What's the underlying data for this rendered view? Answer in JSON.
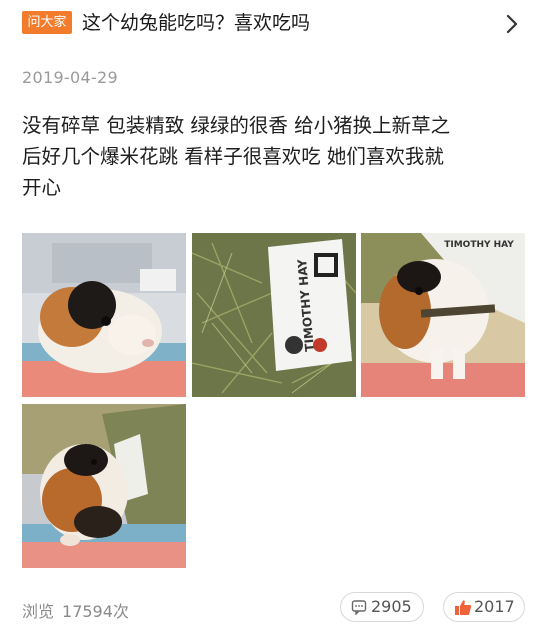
{
  "header": {
    "badge": "问大家",
    "question": "这个幼兔能吃吗？喜欢吃吗"
  },
  "post": {
    "date": "2019-04-29",
    "text_lines": [
      "没有碎草 包装精致 绿绿的很香 给小猪换上新草之",
      "后好几个爆米花跳 看样子很喜欢吃 她们喜欢我就",
      "开心"
    ]
  },
  "photos": [
    {
      "name": "guinea-pig-on-blanket-photo"
    },
    {
      "name": "timothy-hay-bag-photo",
      "bag_text": "TIMOTHY HAY"
    },
    {
      "name": "guinea-pig-eating-hay-photo",
      "bag_text": "TIMOTHY HAY"
    },
    {
      "name": "guinea-pig-beside-bag-photo"
    }
  ],
  "footer": {
    "views_label": "浏览",
    "views_count": "17594次",
    "comments": "2905",
    "likes": "2017"
  },
  "colors": {
    "badge": "#f27c2c",
    "like_icon": "#f0623a",
    "muted_text": "#9a9a9a"
  },
  "icons": {
    "chevron": "chevron-right-icon",
    "comment": "comment-icon",
    "like": "thumbs-up-icon"
  }
}
